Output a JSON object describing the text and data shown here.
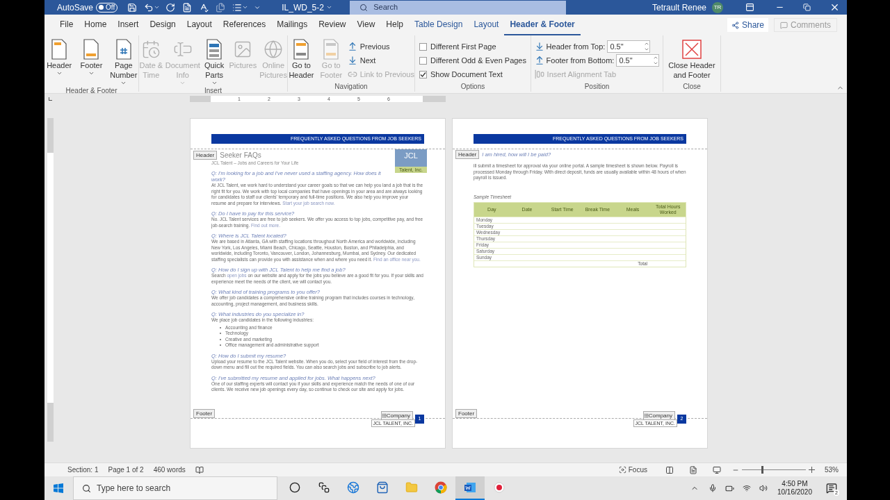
{
  "title_bar": {
    "autosave_label": "AutoSave",
    "autosave": {
      "label": "Off",
      "on": false
    },
    "document": "IL_WD_5-2",
    "search_placeholder": "Search",
    "user": "Tetrault Renee",
    "initials": "TR"
  },
  "tabs": [
    {
      "label": "File",
      "selected": false,
      "kind": "standard"
    },
    {
      "label": "Home",
      "selected": false,
      "kind": "standard"
    },
    {
      "label": "Insert",
      "selected": false,
      "kind": "standard"
    },
    {
      "label": "Design",
      "selected": false,
      "kind": "standard"
    },
    {
      "label": "Layout",
      "selected": false,
      "kind": "standard"
    },
    {
      "label": "References",
      "selected": false,
      "kind": "standard"
    },
    {
      "label": "Mailings",
      "selected": false,
      "kind": "standard"
    },
    {
      "label": "Review",
      "selected": false,
      "kind": "standard"
    },
    {
      "label": "View",
      "selected": false,
      "kind": "standard"
    },
    {
      "label": "Help",
      "selected": false,
      "kind": "standard"
    },
    {
      "label": "Table Design",
      "selected": false,
      "kind": "contextual"
    },
    {
      "label": "Layout",
      "selected": false,
      "kind": "contextual"
    },
    {
      "label": "Header & Footer",
      "selected": true,
      "kind": "contextual"
    }
  ],
  "share": "Share",
  "comments": {
    "label": "Comments",
    "disabled": true
  },
  "ribbon": [
    {
      "label": "Header & Footer",
      "items": [
        {
          "kind": "large",
          "label": "Header",
          "dropdown": true,
          "disabled": false
        },
        {
          "kind": "large",
          "label": "Footer",
          "dropdown": true,
          "disabled": false
        },
        {
          "kind": "large",
          "label": "Page Number",
          "dropdown": true,
          "disabled": false
        }
      ]
    },
    {
      "label": "Insert",
      "items": [
        {
          "kind": "large",
          "label": "Date & Time",
          "dropdown": false,
          "disabled": true
        },
        {
          "kind": "large",
          "label": "Document Info",
          "dropdown": true,
          "disabled": true
        },
        {
          "kind": "large",
          "label": "Quick Parts",
          "dropdown": true,
          "disabled": false
        },
        {
          "kind": "large",
          "label": "Pictures",
          "dropdown": false,
          "disabled": true
        },
        {
          "kind": "large",
          "label": "Online Pictures",
          "dropdown": false,
          "disabled": true
        }
      ]
    },
    {
      "label": "Navigation",
      "items": [
        {
          "kind": "large",
          "label": "Go to Header",
          "dropdown": false,
          "disabled": false
        },
        {
          "kind": "large",
          "label": "Go to Footer",
          "dropdown": false,
          "disabled": true
        },
        {
          "kind": "small",
          "label": "Previous",
          "disabled": false
        },
        {
          "kind": "small",
          "label": "Next",
          "disabled": false
        },
        {
          "kind": "small",
          "label": "Link to Previous",
          "disabled": true
        }
      ]
    },
    {
      "label": "Options",
      "items": [
        {
          "kind": "checkbox",
          "label": "Different First Page",
          "checked": false
        },
        {
          "kind": "checkbox",
          "label": "Different Odd & Even Pages",
          "checked": false
        },
        {
          "kind": "checkbox",
          "label": "Show Document Text",
          "checked": true
        }
      ]
    },
    {
      "label": "Position",
      "items": [
        {
          "kind": "spinner",
          "label": "Header from Top:",
          "value": "0.5\""
        },
        {
          "kind": "spinner",
          "label": "Footer from Bottom:",
          "value": "0.5\""
        },
        {
          "kind": "small",
          "label": "Insert Alignment Tab",
          "disabled": true
        }
      ]
    },
    {
      "label": "Close",
      "items": [
        {
          "kind": "large",
          "label": "Close Header and Footer",
          "dropdown": false,
          "disabled": false
        }
      ]
    }
  ],
  "ruler": [
    "1",
    "2",
    "3",
    "4",
    "5",
    "6"
  ],
  "pages": [
    {
      "banner": "FREQUENTLY ASKED QUESTIONS FROM JOB SEEKERS",
      "header_tag": "Header",
      "logo": {
        "text": "JCL",
        "tagline": "Talent, Inc."
      },
      "blocks": [
        {
          "kind": "title",
          "text": "Seeker FAQs",
          "subtitle": "JCL Talent – Jobs and Careers for Your Life"
        },
        {
          "kind": "faq",
          "question": "Q: I'm looking for a job and I've never used a staffing agency. How does it work?",
          "segments": [
            {
              "kind": "text",
              "text": "At JCL Talent, we work hard to understand your career goals so that we can help you land a job that is the right fit for you. We work with top local companies that have openings in your area and are always looking for candidates to staff our clients' temporary and full-time positions. We also help you improve your resume and prepare for interviews. "
            },
            {
              "kind": "link",
              "text": "Start your job search now."
            }
          ]
        },
        {
          "kind": "faq",
          "question": "Q: Do I have to pay for this service?",
          "segments": [
            {
              "kind": "text",
              "text": "No. JCL Talent services are free to job seekers. We offer you access to top jobs, competitive pay, and free job-search training. "
            },
            {
              "kind": "link",
              "text": "Find out more."
            }
          ]
        },
        {
          "kind": "faq",
          "question": "Q: Where is JCL Talent located?",
          "segments": [
            {
              "kind": "text",
              "text": "We are based in Atlanta, GA with staffing locations throughout North America and worldwide, including New York, Los Angeles, Miami Beach, Chicago, Seattle, Houston, Boston, and Philadelphia, and worldwide, including Toronto, Vancouver, London, Johannesburg, Mumbai, and Sydney. Our dedicated staffing specialists can provide you with assistance when and where you need it. "
            },
            {
              "kind": "link",
              "text": "Find an office near you."
            }
          ]
        },
        {
          "kind": "faq",
          "question": "Q: How do I sign up with JCL Talent to help me find a job?",
          "segments": [
            {
              "kind": "text",
              "text": "Search "
            },
            {
              "kind": "link",
              "text": "open jobs"
            },
            {
              "kind": "text",
              "text": " on our website and apply for the jobs you believe are a good fit for you. If your skills and experience meet the needs of the client, we will contact you."
            }
          ]
        },
        {
          "kind": "faq",
          "question": "Q: What kind of training programs to you offer?",
          "segments": [
            {
              "kind": "text",
              "text": "We offer job candidates a comprehensive online training program that includes courses in technology, accounting, project management, and business skills."
            }
          ]
        },
        {
          "kind": "faq",
          "question": "Q: What industries do you specialize in?",
          "segments": [
            {
              "kind": "text",
              "text": "We place job candidates in the following industries:"
            }
          ],
          "bullets": [
            "Accounting and finance",
            "Technology",
            "Creative and marketing",
            "Office management and administrative support"
          ]
        },
        {
          "kind": "faq",
          "question": "Q: How do I submit my resume?",
          "segments": [
            {
              "kind": "text",
              "text": "Upload your resume to the JCL Talent website. When you do, select your field of interest from the drop-down menu and fill out the required fields. You can also search jobs and subscribe to job alerts."
            }
          ]
        },
        {
          "kind": "faq",
          "question": "Q: I've submitted my resume and applied for jobs. What happens next?",
          "segments": [
            {
              "kind": "text",
              "text": "One of our staffing experts will contact you if your skills and experience match the needs of one of our clients. We receive new job openings every day, so continue to check our site and apply for jobs."
            }
          ]
        }
      ],
      "footer_tag": "Footer",
      "company_tag": "Company",
      "company": "JCL TALENT, INC.",
      "page_number": "1"
    },
    {
      "banner": "FREQUENTLY ASKED QUESTIONS FROM JOB SEEKERS",
      "header_tag": "Header",
      "blocks": [
        {
          "kind": "faq",
          "question": "I am hired, how will I be paid?",
          "segments": [
            {
              "kind": "text",
              "text": "ill submit a timesheet for approval via your online portal. A sample timesheet is shown below. Payroll is processed Monday through Friday. With direct deposit, funds are usually available within 48 hours of when payroll is issued."
            }
          ]
        },
        {
          "kind": "table",
          "caption": "Sample Timesheet",
          "columns": [
            "Day",
            "Date",
            "Start Time",
            "Break Time",
            "Meals",
            "Total Hours Worked"
          ],
          "rows": [
            "Monday",
            "Tuesday",
            "Wednesday",
            "Thursday",
            "Friday",
            "Saturday",
            "Sunday"
          ],
          "total": "Total"
        }
      ],
      "footer_tag": "Footer",
      "company_tag": "Company",
      "company": "JCL TALENT, INC.",
      "page_number": "2"
    }
  ],
  "status_bar": {
    "section": "Section: 1",
    "page": "Page 1 of 2",
    "words": "460 words",
    "focus": "Focus",
    "zoom": "53%",
    "level": 0.3
  },
  "taskbar": {
    "search_placeholder": "Type here to search",
    "apps": [
      {
        "active": false
      },
      {
        "active": false
      },
      {
        "active": false
      },
      {
        "active": false
      },
      {
        "active": false
      },
      {
        "active": false
      },
      {
        "active": true
      },
      {
        "active": false
      }
    ],
    "time": "4:50 PM",
    "date": "10/16/2020",
    "notifications": "2"
  }
}
